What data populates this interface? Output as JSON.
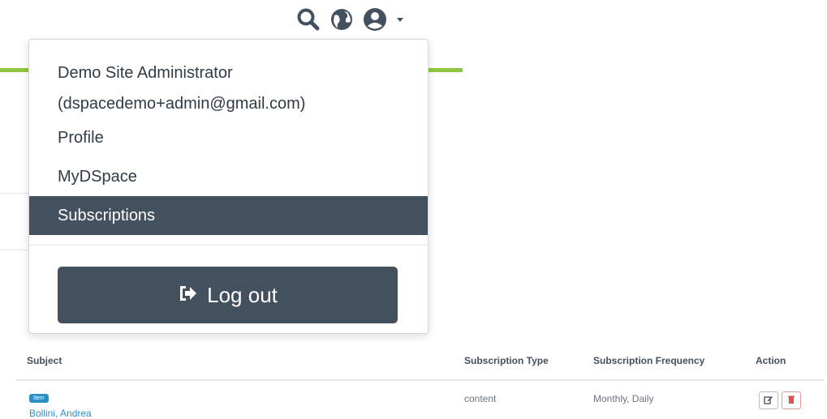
{
  "navbar": {
    "icons": [
      "search-icon",
      "globe-icon",
      "user-circle-icon",
      "caret-down-icon"
    ],
    "accent_color": "#8fc641",
    "icon_color": "#43515f"
  },
  "user_menu": {
    "user_name": "Demo Site Administrator",
    "user_email": "(dspacedemo+admin@gmail.com)",
    "items": [
      {
        "label": "Profile"
      },
      {
        "label": "MyDSpace"
      },
      {
        "label": "Subscriptions",
        "active": true
      }
    ],
    "logout_label": "Log out",
    "active_bg": "#43515f"
  },
  "subscriptions_table": {
    "columns": [
      "Subject",
      "Subscription Type",
      "Subscription Frequency",
      "Action"
    ],
    "rows": [
      {
        "badge": "Item",
        "subject": "Bollini, Andrea",
        "type": "content",
        "frequency": "Monthly, Daily",
        "actions": [
          "edit-icon",
          "trash-icon"
        ]
      }
    ],
    "badge_color": "#2b8fc7"
  }
}
